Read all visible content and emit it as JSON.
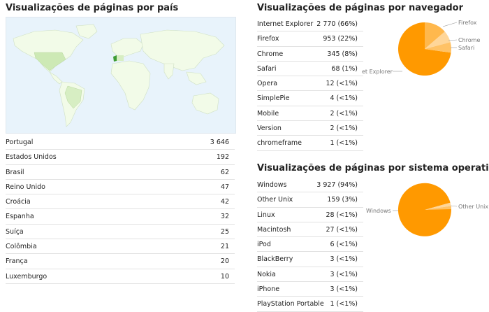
{
  "countries": {
    "title": "Visualizações de páginas por país",
    "rows": [
      {
        "label": "Portugal",
        "value": "3 646"
      },
      {
        "label": "Estados Unidos",
        "value": "192"
      },
      {
        "label": "Brasil",
        "value": "62"
      },
      {
        "label": "Reino Unido",
        "value": "47"
      },
      {
        "label": "Croácia",
        "value": "42"
      },
      {
        "label": "Espanha",
        "value": "32"
      },
      {
        "label": "Suíça",
        "value": "25"
      },
      {
        "label": "Colômbia",
        "value": "21"
      },
      {
        "label": "França",
        "value": "20"
      },
      {
        "label": "Luxemburgo",
        "value": "10"
      }
    ],
    "map_colors": {
      "ocean": "#e8f3fb",
      "land": "#f2fbe8",
      "highlight_low": "#cde9b5",
      "highlight_high": "#3e9c35"
    }
  },
  "browsers": {
    "title": "Visualizações de páginas por navegador",
    "rows": [
      {
        "label": "Internet Explorer",
        "value": "2 770  (66%)"
      },
      {
        "label": "Firefox",
        "value": "953  (22%)"
      },
      {
        "label": "Chrome",
        "value": "345  (8%)"
      },
      {
        "label": "Safari",
        "value": "68  (1%)"
      },
      {
        "label": "Opera",
        "value": "12  (<1%)"
      },
      {
        "label": "SimplePie",
        "value": "4  (<1%)"
      },
      {
        "label": "Mobile",
        "value": "2  (<1%)"
      },
      {
        "label": "Version",
        "value": "2  (<1%)"
      },
      {
        "label": "chromeframe",
        "value": "1  (<1%)"
      }
    ],
    "pie_labels": {
      "firefox": "Firefox",
      "chrome": "Chrome",
      "safari": "Safari",
      "ie": "et Explorer"
    }
  },
  "os": {
    "title": "Visualizações de páginas por sistema operativo",
    "rows": [
      {
        "label": "Windows",
        "value": "3 927  (94%)"
      },
      {
        "label": "Other Unix",
        "value": "159  (3%)"
      },
      {
        "label": "Linux",
        "value": "28  (<1%)"
      },
      {
        "label": "Macintosh",
        "value": "27  (<1%)"
      },
      {
        "label": "iPod",
        "value": "6  (<1%)"
      },
      {
        "label": "BlackBerry",
        "value": "3  (<1%)"
      },
      {
        "label": "Nokia",
        "value": "3  (<1%)"
      },
      {
        "label": "iPhone",
        "value": "3  (<1%)"
      },
      {
        "label": "PlayStation Portable",
        "value": "1  (<1%)"
      }
    ],
    "pie_labels": {
      "windows": "Windows",
      "other_unix": "Other Unix"
    }
  },
  "colors": {
    "pie_main": "#ff9900",
    "pie_light": "#ffb84d",
    "pie_lighter": "#ffd699",
    "leader": "#999999"
  }
}
